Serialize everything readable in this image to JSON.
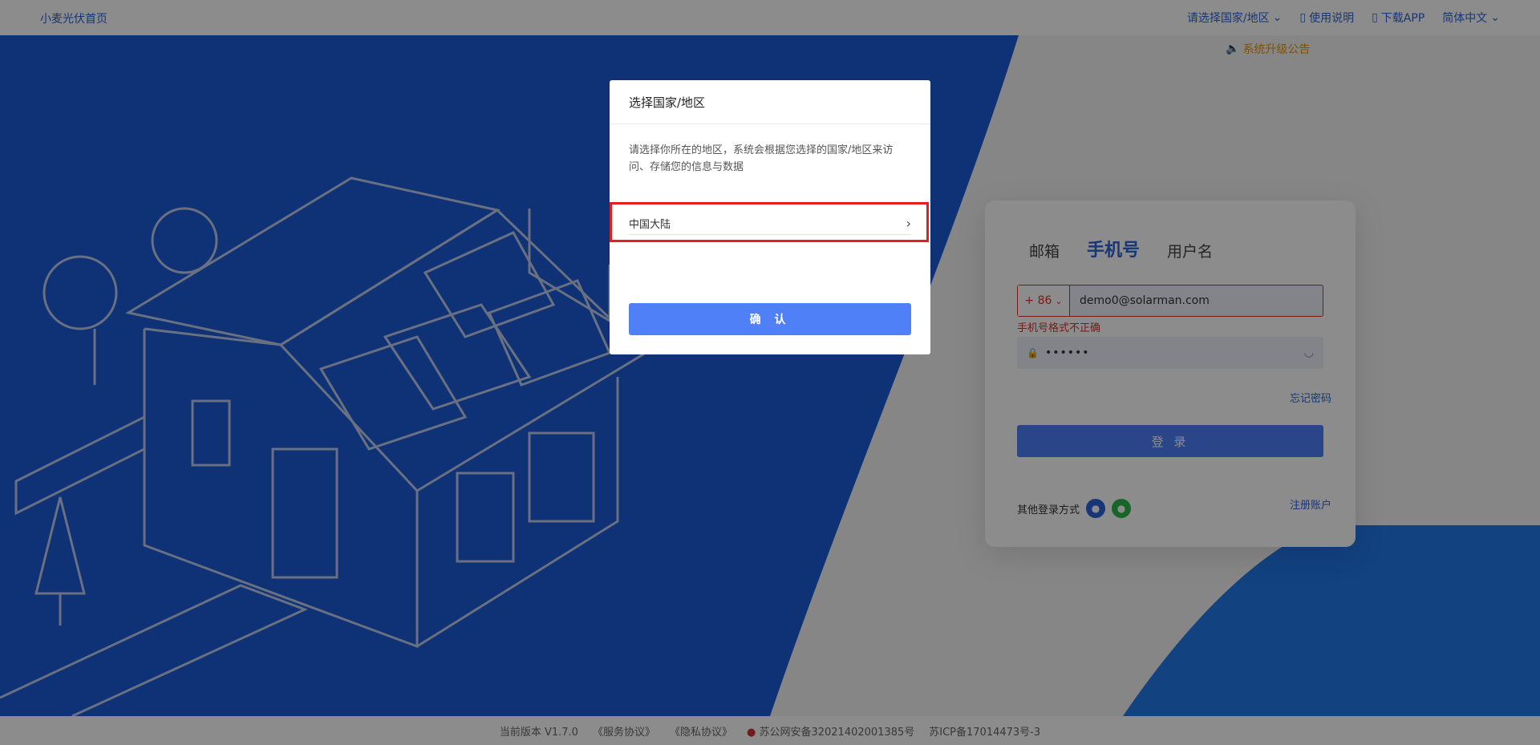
{
  "header": {
    "brand": "小麦光伏首页",
    "nav": [
      {
        "label": "请选择国家/地区",
        "icon": "chevron-down-icon"
      },
      {
        "label": "使用说明",
        "icon": "book-icon"
      },
      {
        "label": "下载APP",
        "icon": "phone-icon"
      },
      {
        "label": "简体中文",
        "icon": "chevron-down-icon"
      }
    ],
    "notice": "系统升级公告"
  },
  "login": {
    "tabs": [
      "邮箱",
      "手机号",
      "用户名"
    ],
    "active_tab": "手机号",
    "country_code": "+ 86",
    "phone_value": "demo0@solarman.com",
    "error": "手机号格式不正确",
    "password_value": "••••••",
    "forgot": "忘记密码",
    "login_button": "登 录",
    "other_methods": "其他登录方式",
    "register": "注册账户"
  },
  "footer": {
    "version": "当前版本 V1.7.0",
    "service": "《服务协议》",
    "privacy": "《隐私协议》",
    "police": "苏公网安备32021402001385号",
    "icp": "苏ICP备17014473号-3"
  },
  "modal": {
    "title": "选择国家/地区",
    "description": "请选择你所在的地区，系统会根据您选择的国家/地区来访问、存储您的信息与数据",
    "region": "中国大陆",
    "confirm": "确 认"
  },
  "colors": {
    "primary": "#2b63d9",
    "button": "#4f80f7",
    "error": "#e02f2f",
    "highlight_border": "#e81d1d",
    "background_blue": "#1a5bd6"
  }
}
